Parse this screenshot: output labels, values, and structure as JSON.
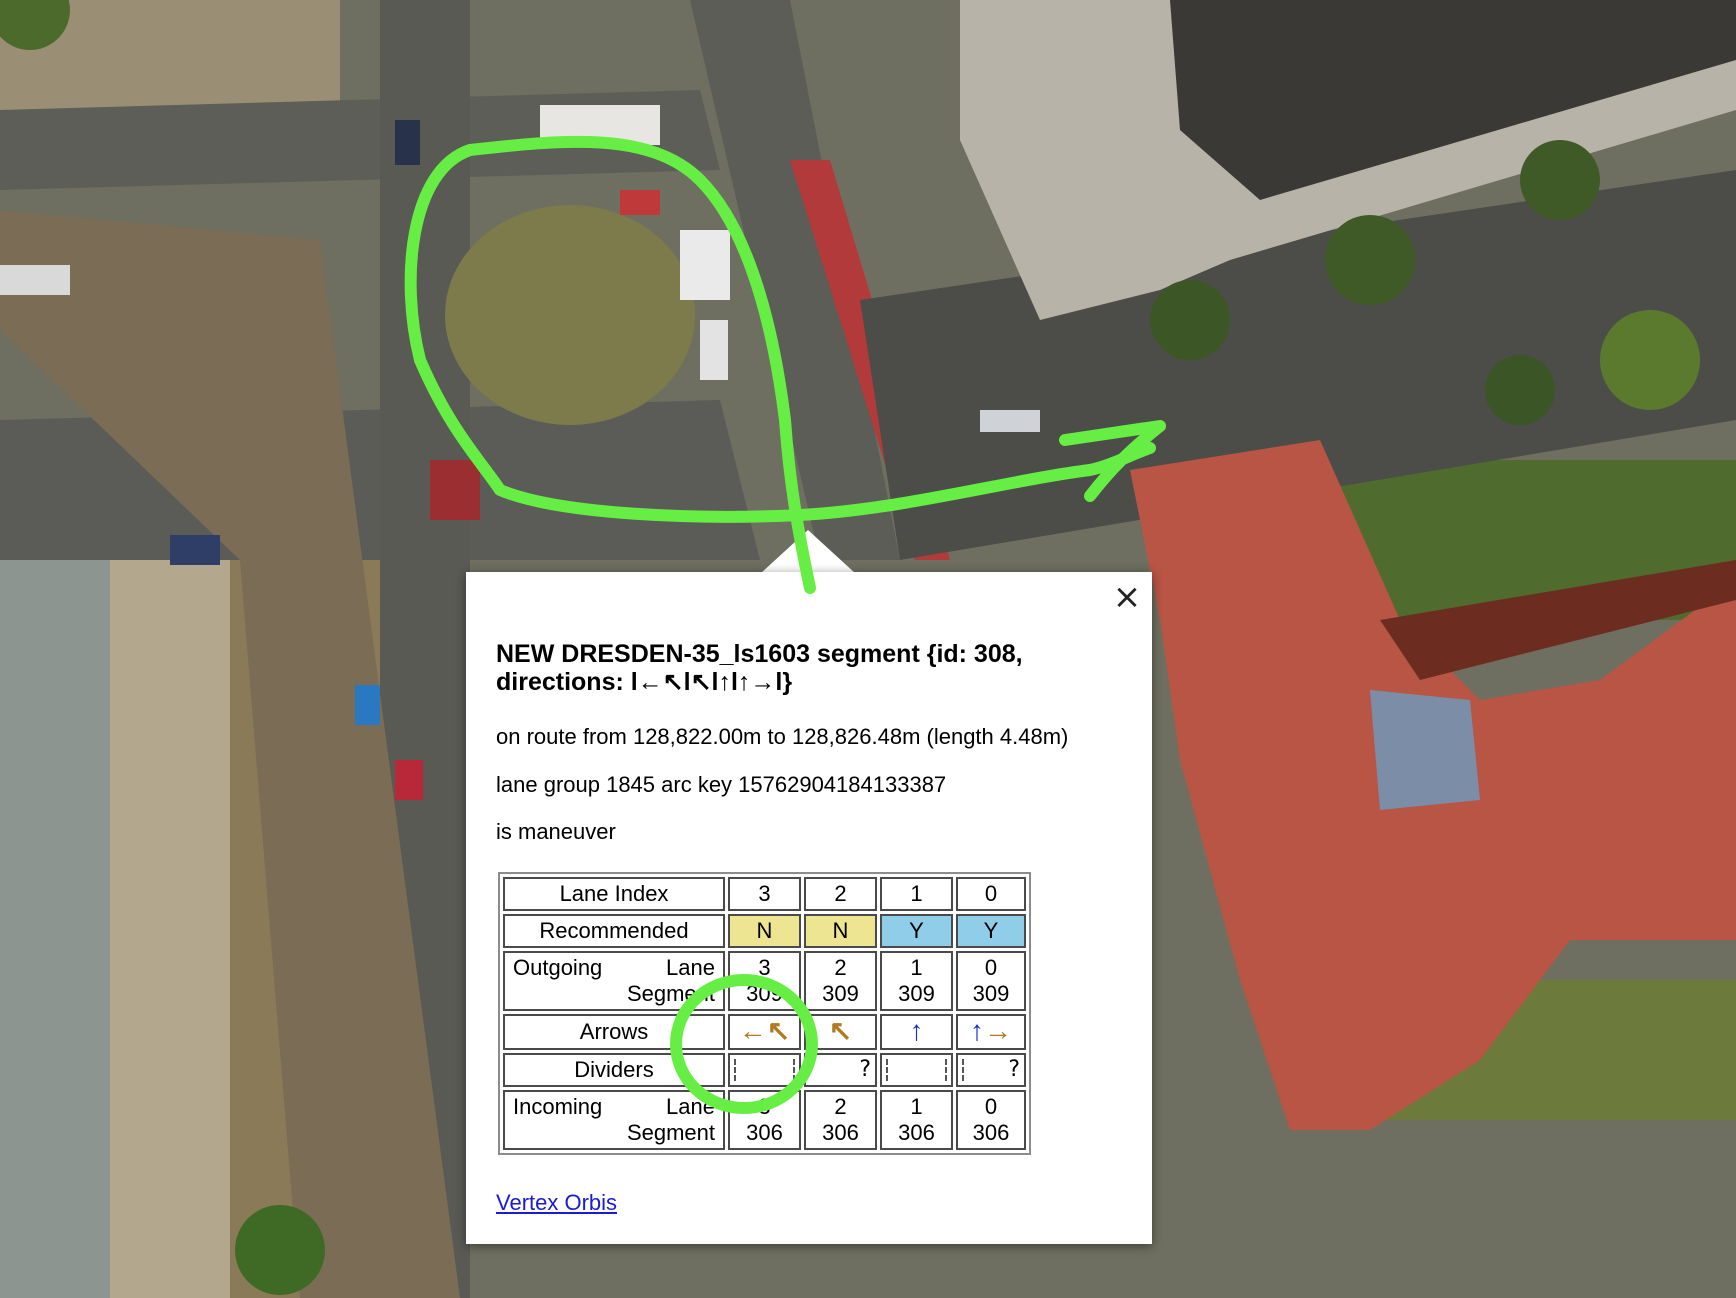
{
  "popup": {
    "title_line1": "NEW DRESDEN-35_ls1603 segment {id: 308,",
    "title_line2": "directions: l←↖l↖l↑l↑→l}",
    "route": "on route from 128,822.00m to 128,826.48m (length 4.48m)",
    "lane_group": "lane group 1845 arc key 15762904184133387",
    "maneuver": "is maneuver",
    "close_icon": "×",
    "link": "Vertex Orbis"
  },
  "table": {
    "lane_index_label": "Lane Index",
    "lane_indexes": [
      "3",
      "2",
      "1",
      "0"
    ],
    "recommended_label": "Recommended",
    "recommended": [
      "N",
      "N",
      "Y",
      "Y"
    ],
    "outgoing_label_a": "Outgoing",
    "outgoing_label_b": "Lane",
    "outgoing_label_c": "Segment",
    "outgoing": [
      {
        "lane": "3",
        "segment": "309"
      },
      {
        "lane": "2",
        "segment": "309"
      },
      {
        "lane": "1",
        "segment": "309"
      },
      {
        "lane": "0",
        "segment": "309"
      }
    ],
    "arrows_label": "Arrows",
    "arrows": [
      {
        "left": "←",
        "right": "↖"
      },
      {
        "left": "↖",
        "right": ""
      },
      {
        "left": "↑",
        "right": ""
      },
      {
        "left": "↑",
        "right": "→"
      }
    ],
    "dividers_label": "Dividers",
    "dividers_q": "?",
    "incoming_label_a": "Incoming",
    "incoming_label_b": "Lane",
    "incoming_label_c": "Segment",
    "incoming": [
      {
        "lane": "3",
        "segment": "306"
      },
      {
        "lane": "2",
        "segment": "306"
      },
      {
        "lane": "1",
        "segment": "306"
      },
      {
        "lane": "0",
        "segment": "306"
      }
    ]
  },
  "colors": {
    "recommended_no": "#ede591",
    "recommended_yes": "#8fcde8",
    "arrow_brown": "#b07a22",
    "arrow_blue": "#1a2fc4",
    "annotation_green": "#66ee44"
  }
}
